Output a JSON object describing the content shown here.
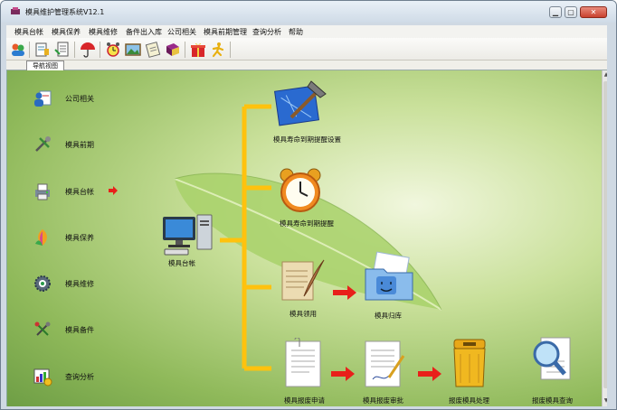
{
  "window": {
    "title": "模具维护管理系统V12.1",
    "min_icon": "minimize-icon",
    "max_icon": "maximize-icon",
    "close_icon": "close-icon"
  },
  "menu": [
    "模具台帐",
    "模具保养",
    "模具维修",
    "备件出入库",
    "公司相关",
    "模具前期管理",
    "查询分析",
    "帮助"
  ],
  "toolbar": {
    "icons": [
      "users-icon",
      "document-edit-icon",
      "document-list-icon",
      "umbrella-icon",
      "alarm-clock-icon",
      "picture-icon",
      "notepad-icon",
      "book-icon",
      "gift-box-icon",
      "running-man-icon"
    ]
  },
  "tab": {
    "label": "导航视图"
  },
  "nav": [
    {
      "label": "公司相关",
      "icon": "company-person-icon"
    },
    {
      "label": "模具前期",
      "icon": "tools-icon"
    },
    {
      "label": "模具台帐",
      "icon": "printer-ledger-icon",
      "selected": true
    },
    {
      "label": "模具保养",
      "icon": "maintenance-leaf-icon"
    },
    {
      "label": "模具维修",
      "icon": "repair-gear-icon"
    },
    {
      "label": "模具备件",
      "icon": "parts-icon"
    },
    {
      "label": "查询分析",
      "icon": "chart-query-icon"
    }
  ],
  "diagram": {
    "center": {
      "label": "模具台帐",
      "icon": "computer-icon"
    },
    "nodes": [
      {
        "label": "模具寿命到期提醒设置",
        "icon": "blueprint-hammer-icon"
      },
      {
        "label": "模具寿命到期提醒",
        "icon": "alarm-clock-icon"
      },
      {
        "label": "模具领用",
        "icon": "scroll-quill-icon"
      },
      {
        "label": "模具归库",
        "icon": "finder-folder-icon"
      },
      {
        "label": "模具报废申请",
        "icon": "paper-document-icon"
      },
      {
        "label": "模具报废审批",
        "icon": "paper-signature-icon"
      },
      {
        "label": "报废模具处理",
        "icon": "trash-bin-icon"
      },
      {
        "label": "报废模具查询",
        "icon": "magnifier-document-icon"
      }
    ]
  },
  "colors": {
    "connector": "#ffc20e",
    "arrow": "#e8201a",
    "close_button": "#c9412e"
  }
}
